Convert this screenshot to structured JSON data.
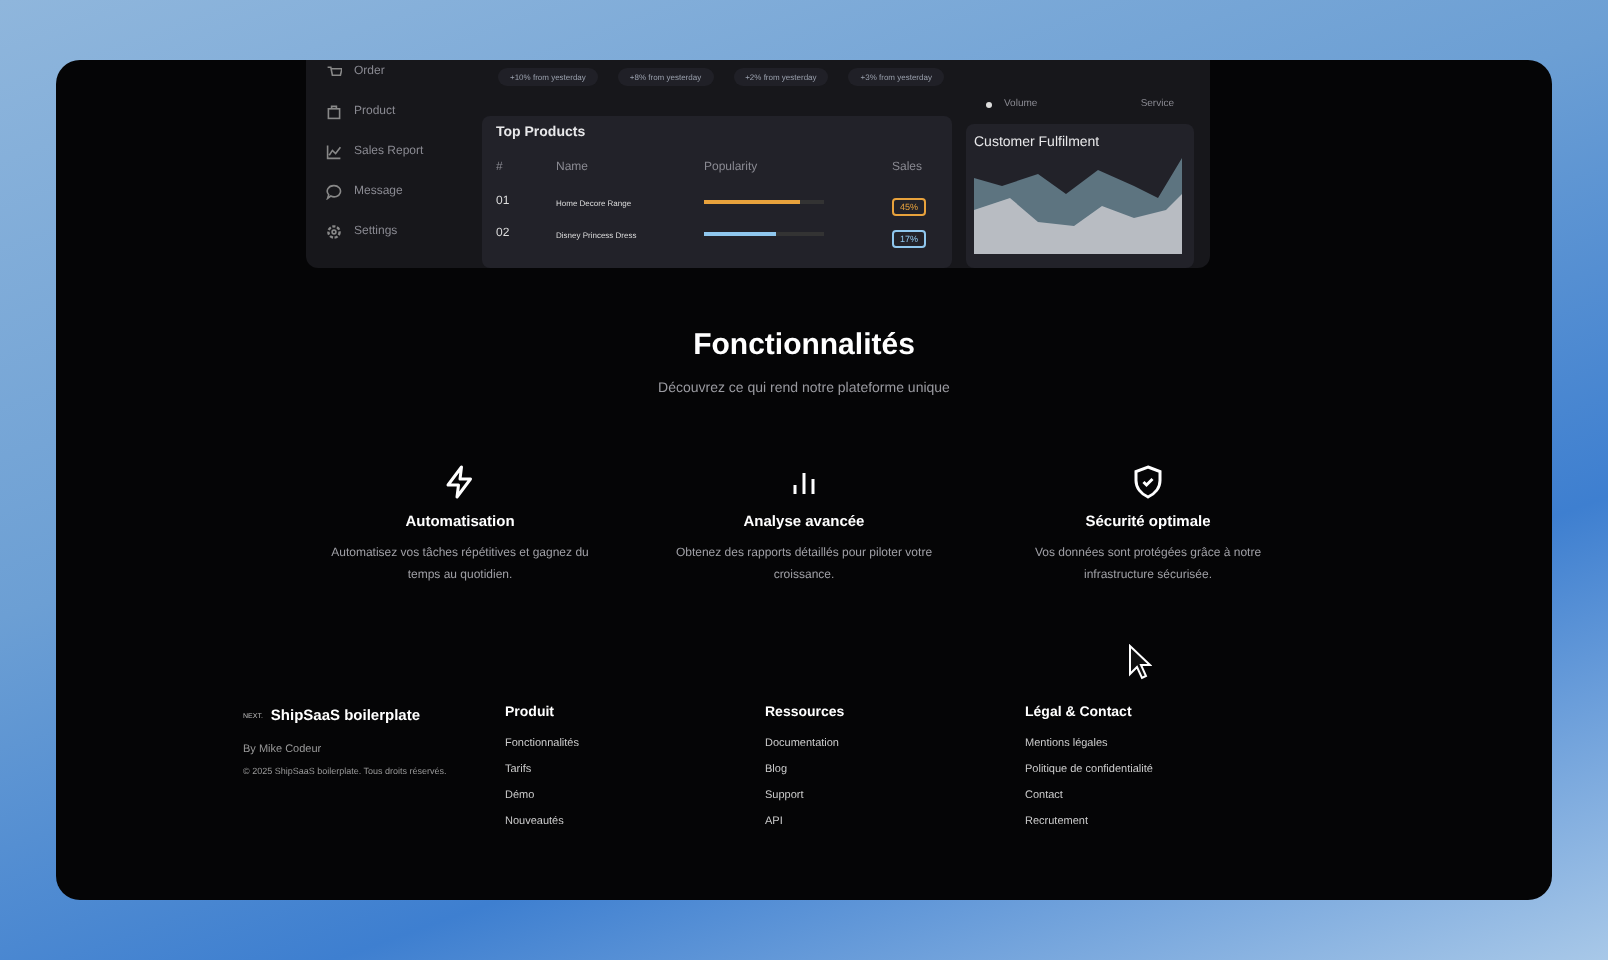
{
  "dashboard": {
    "sidebar": {
      "items": [
        {
          "label": "Order"
        },
        {
          "label": "Product"
        },
        {
          "label": "Sales Report"
        },
        {
          "label": "Message"
        },
        {
          "label": "Settings"
        }
      ]
    },
    "stats": [
      {
        "change": "+10% from yesterday"
      },
      {
        "change": "+8% from yesterday"
      },
      {
        "change": "+2% from yesterday"
      },
      {
        "change": "+3% from yesterday"
      }
    ],
    "top_products": {
      "title": "Top Products",
      "columns": [
        "#",
        "Name",
        "Popularity",
        "Sales"
      ],
      "rows": [
        {
          "index": "01",
          "name": "Home Decore Range",
          "level": 0.8,
          "sales": "45%",
          "color": "#e8a23c"
        },
        {
          "index": "02",
          "name": "Disney Princess Dress",
          "level": 0.6,
          "sales": "17%",
          "color": "#8fc7ee"
        }
      ]
    },
    "legend": [
      "Volume",
      "Service"
    ],
    "fulfilment": {
      "title": "Customer Fulfilment"
    }
  },
  "features": {
    "title": "Fonctionnalités",
    "subtitle": "Découvrez ce qui rend notre plateforme unique",
    "items": [
      {
        "title": "Automatisation",
        "text": "Automatisez vos tâches répétitives et gagnez du temps au quotidien."
      },
      {
        "title": "Analyse avancée",
        "text": "Obtenez des rapports détaillés pour piloter votre croissance."
      },
      {
        "title": "Sécurité optimale",
        "text": "Vos données sont protégées grâce à notre infrastructure sécurisée."
      }
    ]
  },
  "footer": {
    "logo": "NEXT.",
    "brand": "ShipSaaS boilerplate",
    "author": "By Mike Codeur",
    "copyright": "© 2025 ShipSaaS boilerplate. Tous droits réservés.",
    "columns": [
      {
        "title": "Produit",
        "links": [
          "Fonctionnalités",
          "Tarifs",
          "Démo",
          "Nouveautés"
        ]
      },
      {
        "title": "Ressources",
        "links": [
          "Documentation",
          "Blog",
          "Support",
          "API"
        ]
      },
      {
        "title": "Légal & Contact",
        "links": [
          "Mentions légales",
          "Politique de confidentialité",
          "Contact",
          "Recrutement"
        ]
      }
    ]
  }
}
